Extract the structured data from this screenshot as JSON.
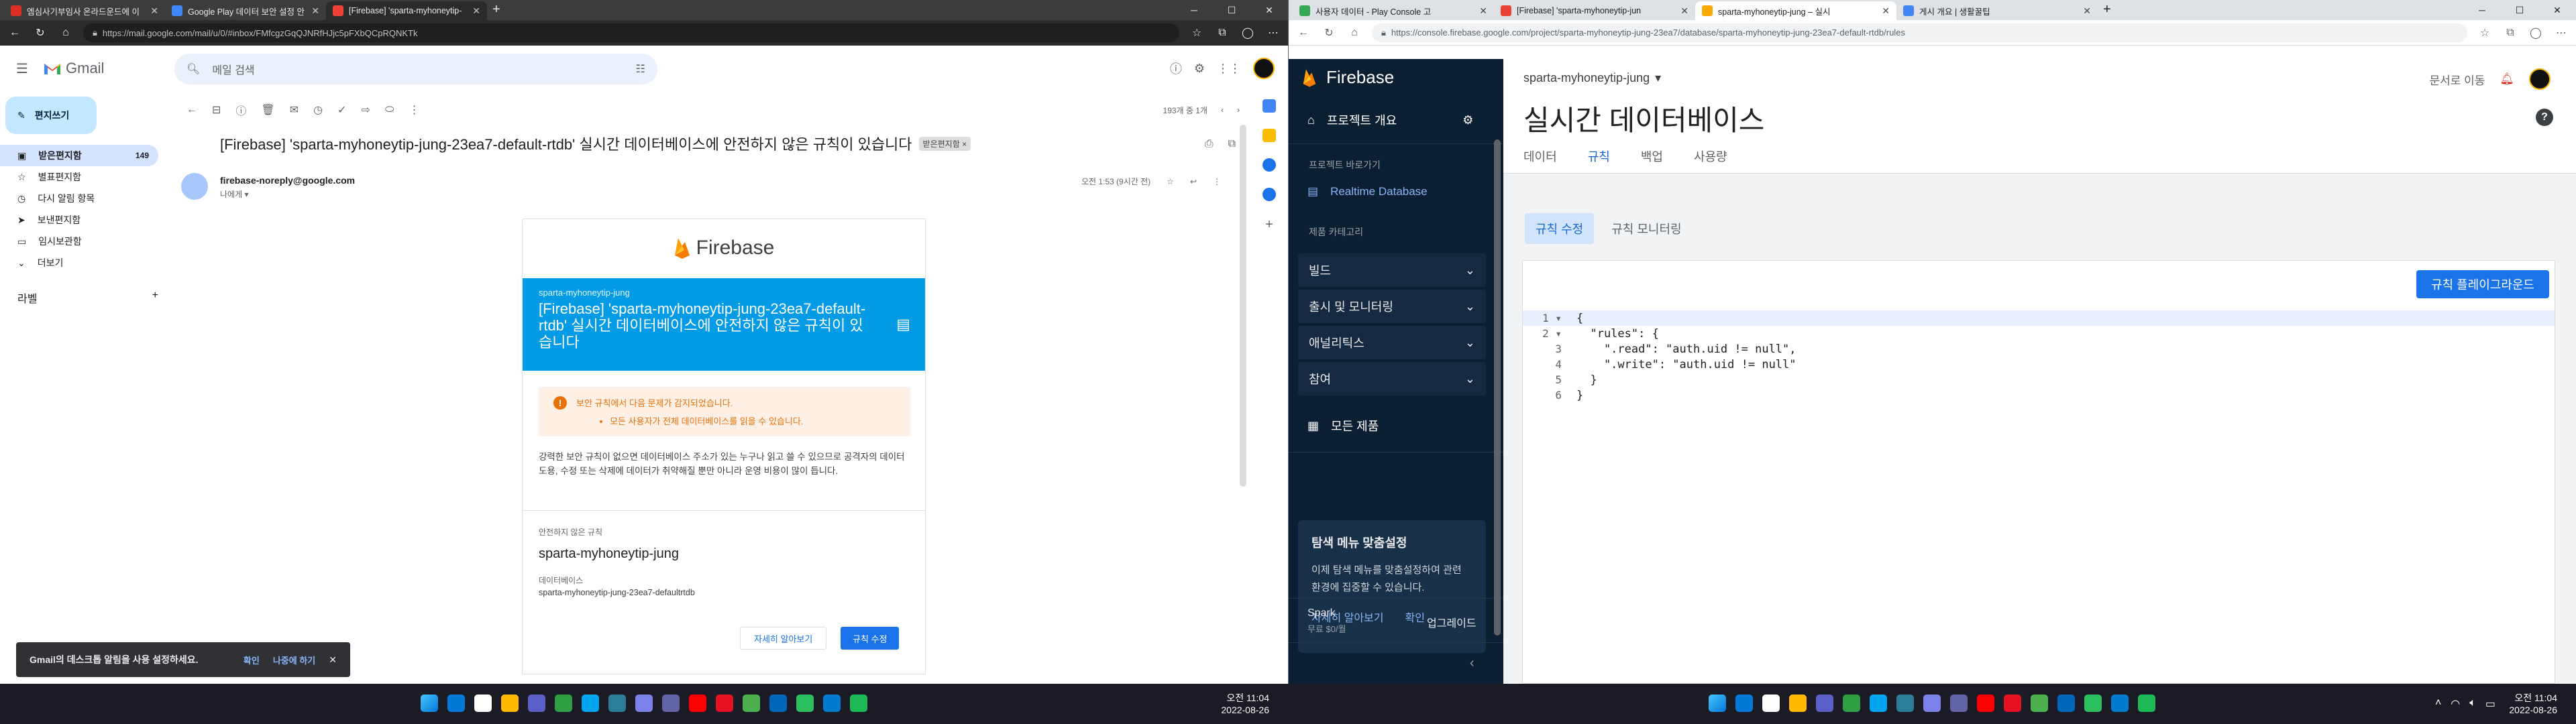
{
  "left_window": {
    "tabs": [
      {
        "label": "엠심사기부임사 온라드운드에 이",
        "color": "#d93025",
        "active": false
      },
      {
        "label": "Google Play 데이터 보안 설정 안",
        "color": "#4285f4",
        "active": false
      },
      {
        "label": "[Firebase] 'sparta-myhoneytip-",
        "color": "#ea4335",
        "active": true
      }
    ],
    "url": "https://mail.google.com/mail/u/0/#inbox/FMfcgzGqQJNRfHJjc5pFXbQCpRQNKTk",
    "gmail": {
      "logo_text": "Gmail",
      "search_placeholder": "메일 검색",
      "compose_label": "편지쓰기",
      "nav_items": [
        {
          "label": "받은편지함",
          "count": "149",
          "selected": true,
          "icon": "inbox-icon"
        },
        {
          "label": "별표편지함",
          "count": "",
          "selected": false,
          "icon": "star-icon"
        },
        {
          "label": "다시 알림 항목",
          "count": "",
          "selected": false,
          "icon": "clock-icon"
        },
        {
          "label": "보낸편지함",
          "count": "",
          "selected": false,
          "icon": "send-icon"
        },
        {
          "label": "임시보관함",
          "count": "",
          "selected": false,
          "icon": "draft-icon"
        },
        {
          "label": "더보기",
          "count": "",
          "selected": false,
          "icon": "chevron-down-icon"
        }
      ],
      "labels_header": "라벨",
      "pagination": "193개 중 1개",
      "subject": "[Firebase] 'sparta-myhoneytip-jung-23ea7-default-rtdb' 실시간 데이터베이스에 안전하지 않은 규칙이 있습니다",
      "subject_label": "받은편지함 ×",
      "sender": "firebase-noreply@google.com",
      "to_me": "나에게 ▾",
      "time": "오전 1:53 (9시간 전)",
      "email": {
        "brand": "Firebase",
        "banner_small": "sparta-myhoneytip-jung",
        "banner_title": "[Firebase] 'sparta-myhoneytip-jung-23ea7-default-rtdb' 실시간 데이터베이스에 안전하지 않은 규칙이 있습니다",
        "warning_title": "보안 규칙에서 다음 문제가 감지되었습니다.",
        "warning_item": "모든 사용자가 전체 데이터베이스를 읽을 수 있습니다.",
        "paragraph": "강력한 보안 규칙이 없으면 데이터베이스 주소가 있는 누구나 읽고 쓸 수 있으므로 공격자의 데이터 도용, 수정 또는 삭제에 데이터가 취약해질 뿐만 아니라 운영 비용이 많이 듭니다.",
        "insecure_rules_label": "안전하지 않은 규칙",
        "project_name": "sparta-myhoneytip-jung",
        "database_label": "데이터베이스",
        "database_value": "sparta-myhoneytip-jung-23ea7-defaultrtdb",
        "learn_more_button": "자세히 알아보기",
        "edit_rules_button": "규칙 수정"
      },
      "toast": {
        "text": "Gmail의 데스크톱 알림을 사용 설정하세요.",
        "ok": "확인",
        "later": "나중에 하기"
      }
    }
  },
  "right_window": {
    "tabs": [
      {
        "label": "사용자 데이터 - Play Console 고",
        "color": "#34a853",
        "active": false
      },
      {
        "label": "[Firebase] 'sparta-myhoneytip-jun",
        "color": "#ea4335",
        "active": false
      },
      {
        "label": "sparta-myhoneytip-jung – 실시",
        "color": "#f9ab00",
        "active": true
      },
      {
        "label": "게시 개요 | 생활꿀팁",
        "color": "#4285f4",
        "active": false
      }
    ],
    "url": "https://console.firebase.google.com/project/sparta-myhoneytip-jung-23ea7/database/sparta-myhoneytip-jung-23ea7-default-rtdb/rules",
    "firebase": {
      "brand": "Firebase",
      "project_selector": "sparta-myhoneytip-jung",
      "docs_link": "문서로 이동",
      "sidebar": {
        "overview": "프로젝트 개요",
        "shortcuts_caption": "프로젝트 바로가기",
        "realtime_db": "Realtime Database",
        "product_caption": "제품 카테고리",
        "groups": [
          "빌드",
          "출시 및 모니터링",
          "애널리틱스",
          "참여"
        ],
        "all_products": "모든 제품",
        "card_title": "탐색 메뉴 맞춤설정",
        "card_text": "이제 탐색 메뉴를 맞춤설정하여 관련 환경에 집중할 수 있습니다.",
        "card_learn": "자세히 알아보기",
        "card_ok": "확인",
        "plan": "Spark",
        "plan_price": "무료 $0/월",
        "upgrade": "업그레이드"
      },
      "page_title": "실시간 데이터베이스",
      "tabs": [
        "데이터",
        "규칙",
        "백업",
        "사용량"
      ],
      "active_tab": "규칙",
      "subtabs": [
        "규칙 수정",
        "규칙 모니터링"
      ],
      "playground_button": "규칙 플레이그라운드",
      "code_lines": [
        {
          "n": "1",
          "fold": "▾",
          "text": "{"
        },
        {
          "n": "2",
          "fold": "▾",
          "text": "  \"rules\": {"
        },
        {
          "n": "3",
          "fold": "",
          "text": "    \".read\": \"auth.uid != null\","
        },
        {
          "n": "4",
          "fold": "",
          "text": "    \".write\": \"auth.uid != null\""
        },
        {
          "n": "5",
          "fold": "",
          "text": "  }"
        },
        {
          "n": "6",
          "fold": "",
          "text": "}"
        }
      ]
    }
  },
  "taskbar": {
    "left_clock_time": "오전 11:04",
    "left_clock_date": "2022-08-26",
    "right_clock_time": "오전 11:04",
    "right_clock_date": "2022-08-26",
    "app_icon_colors": [
      "#0078d4",
      "#ffffff",
      "#ffb900",
      "#5b5fc7",
      "#2ea043",
      "#00a4ef",
      "#2d7d9a",
      "#7b83eb",
      "#6264a7",
      "#ff0000",
      "#e81123",
      "#4caf50",
      "#0067b8",
      "#2dbe60",
      "#007acc",
      "#1db954"
    ]
  }
}
